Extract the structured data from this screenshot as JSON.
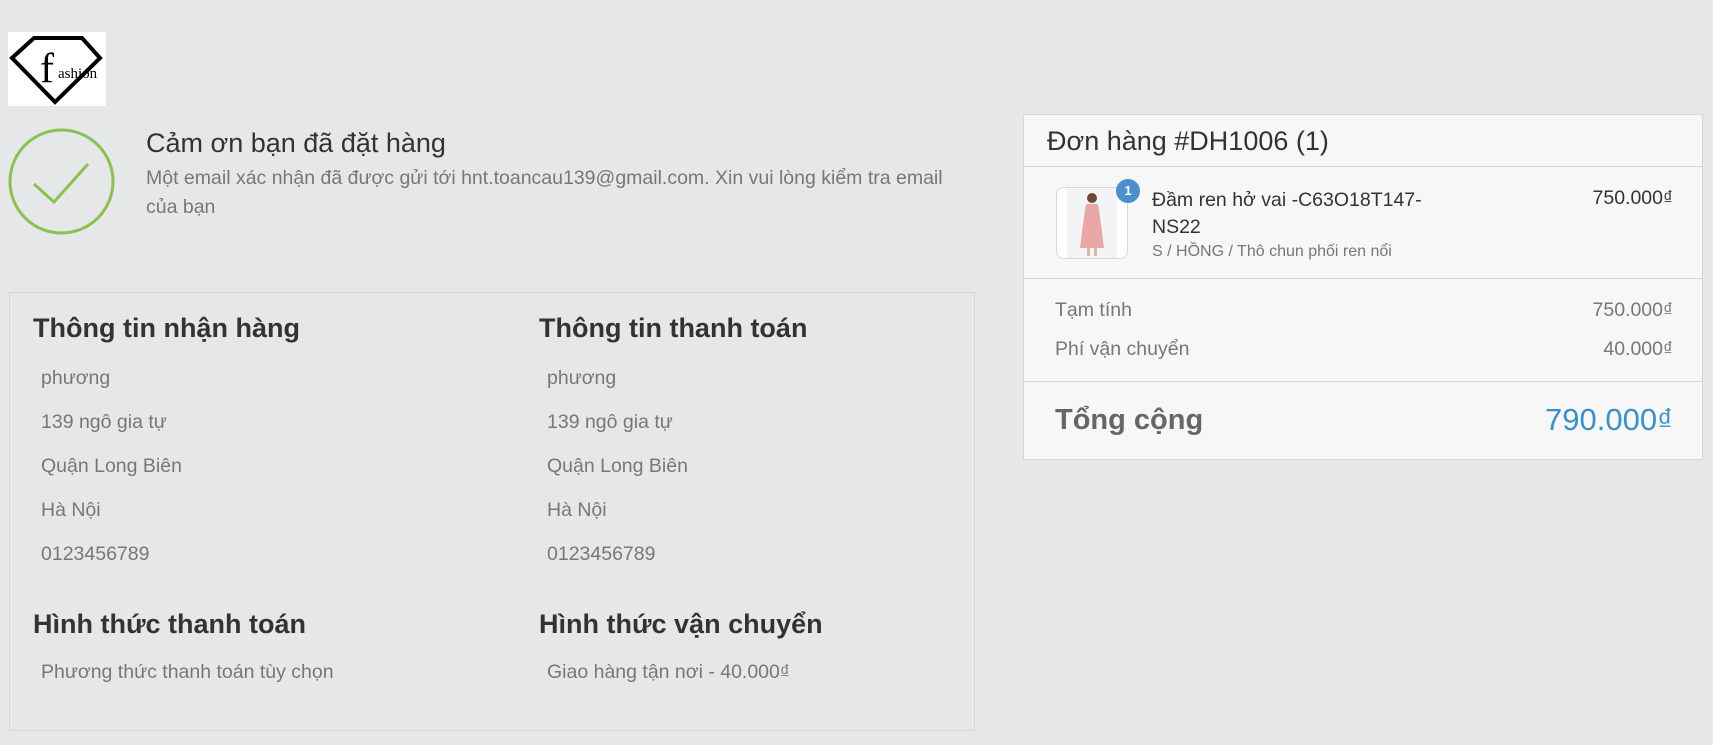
{
  "logo": {
    "brand_mark": "f",
    "brand_text": "ashion"
  },
  "confirmation": {
    "title": "Cảm ơn bạn đã đặt hàng",
    "message": "Một email xác nhận đã được gửi tới hnt.toancau139@gmail.com. Xin vui lòng kiểm tra email của bạn",
    "icon": "checkmark-icon",
    "accent_color": "#8cc152"
  },
  "shipping_info": {
    "title": "Thông tin nhận hàng",
    "lines": [
      "phương",
      "139 ngô gia tự",
      "Quận Long Biên",
      "Hà Nội",
      "0123456789"
    ]
  },
  "billing_info": {
    "title": "Thông tin thanh toán",
    "lines": [
      "phương",
      "139 ngô gia tự",
      "Quận Long Biên",
      "Hà Nội",
      "0123456789"
    ]
  },
  "payment_method": {
    "title": "Hình thức thanh toán",
    "value": "Phương thức thanh toán tùy chọn"
  },
  "shipping_method": {
    "title": "Hình thức vận chuyển",
    "value": "Giao hàng tận nơi - 40.000₫"
  },
  "order": {
    "header": "Đơn hàng #DH1006 (1)",
    "item": {
      "quantity": "1",
      "name": "Đầm ren hở vai -C63O18T147-NS22",
      "variant": "S / HỒNG / Thô chun phối ren nổi",
      "price": "750.000₫"
    },
    "subtotal_label": "Tạm tính",
    "subtotal_value": "750.000₫",
    "shipping_label": "Phí vận chuyển",
    "shipping_value": "40.000₫",
    "total_label": "Tổng cộng",
    "total_value": "790.000₫",
    "total_color": "#3c8fc9"
  }
}
